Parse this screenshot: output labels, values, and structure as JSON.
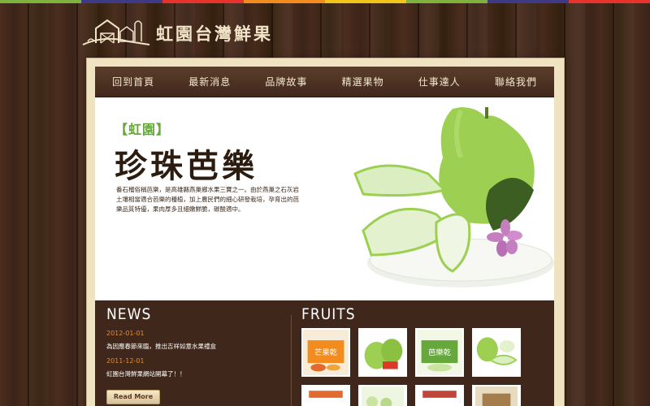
{
  "strip_colors": [
    "#7fb141",
    "#3f3a86",
    "#e7322d",
    "#f28c1f",
    "#f3c51b",
    "#7fb141",
    "#3f3a86",
    "#e7322d"
  ],
  "site": {
    "name": "虹園台灣鮮果"
  },
  "nav": {
    "items": [
      {
        "label": "回到首頁"
      },
      {
        "label": "最新消息"
      },
      {
        "label": "品牌故事"
      },
      {
        "label": "精選果物"
      },
      {
        "label": "仕事達人"
      },
      {
        "label": "聯絡我們"
      }
    ]
  },
  "banner": {
    "tag": "【虹園】",
    "headline": "珍珠芭樂",
    "description": "番石榴俗稱芭樂，是高雄縣燕巢鄉水果三寶之一。由於燕巢之石灰岩土壤相當適合芭樂的種植，加上農民們的細心研發栽培，孕育出的芭樂品質特優，果肉厚多且細嫩鮮脆，碳酸適中。"
  },
  "news": {
    "title": "NEWS",
    "items": [
      {
        "date": "2012-01-01",
        "title": "為因應春節來臨，推出吉祥如意水果禮盒"
      },
      {
        "date": "2011-12-01",
        "title": "虹園台灣鮮果網站開幕了！！"
      }
    ],
    "read_more": "Read More"
  },
  "fruits": {
    "title": "FRUITS",
    "row1": [
      {
        "label": "芒果乾"
      },
      {
        "label": ""
      },
      {
        "label": "芭樂乾"
      },
      {
        "label": ""
      }
    ]
  }
}
